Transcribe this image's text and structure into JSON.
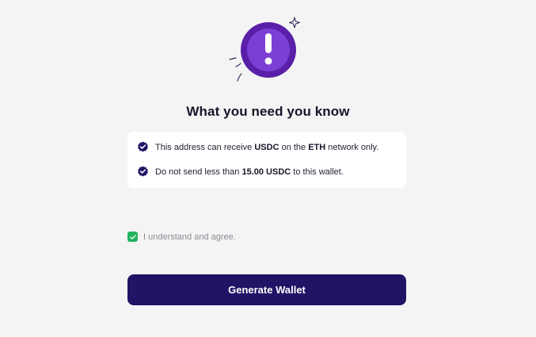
{
  "heading": {
    "title": "What you need you know"
  },
  "notices": {
    "row1": {
      "prefix": "This address can receive ",
      "token": "USDC",
      "middle": " on the ",
      "network": "ETH",
      "suffix": " network only."
    },
    "row2": {
      "prefix": "Do not send less than ",
      "amount": "15.00 USDC",
      "suffix": " to this wallet."
    }
  },
  "agreement": {
    "label": "I understand and agree.",
    "checked": true
  },
  "actions": {
    "generate_label": "Generate Wallet"
  },
  "colors": {
    "primary": "#1f1466",
    "warning_icon": "#6a2cc4",
    "check_green": "#22b35e",
    "background": "#f4f4f4"
  },
  "icons": {
    "hero": "exclamation-icon",
    "notice": "check-circle-icon",
    "agree": "checkbox-checked-icon"
  }
}
